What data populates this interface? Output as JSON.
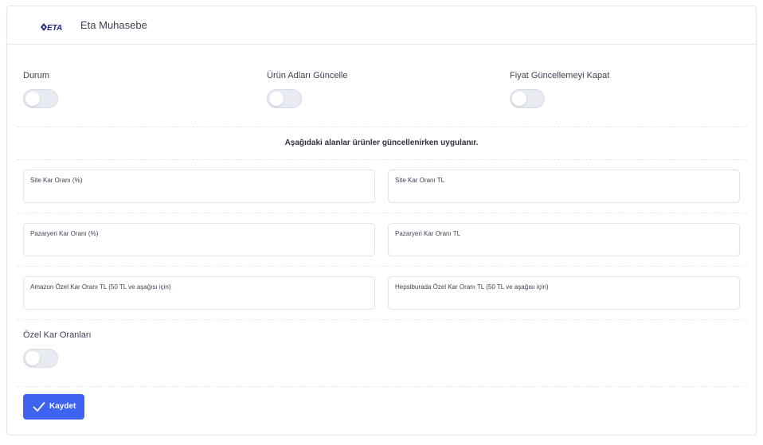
{
  "header": {
    "logo_text": "ETA",
    "title": "Eta Muhasebe"
  },
  "toggles": {
    "durum": {
      "label": "Durum",
      "checked": false
    },
    "urun_adlari": {
      "label": "Ürün Adları Güncelle",
      "checked": false
    },
    "fiyat_kapat": {
      "label": "Fiyat Güncellemeyi Kapat",
      "checked": false
    },
    "ozel_kar": {
      "label": "Özel Kar Oranları",
      "checked": false
    }
  },
  "section_note": "Aşağıdaki alanlar ürünler güncellenirken uygulanır.",
  "fields": {
    "site_kar_yuzde": {
      "label": "Site Kar Oranı (%)",
      "value": ""
    },
    "site_kar_tl": {
      "label": "Site Kar Oranı TL",
      "value": ""
    },
    "pazaryeri_kar_yuzde": {
      "label": "Pazaryeri Kar Oranı (%)",
      "value": ""
    },
    "pazaryeri_kar_tl": {
      "label": "Pazaryeri Kar Oranı TL",
      "value": ""
    },
    "amazon_ozel": {
      "label": "Amazon Özel Kar Oranı TL (50 TL ve aşağısı için)",
      "value": ""
    },
    "hepsiburada_ozel": {
      "label": "Hepsiburada Özel Kar Oranı TL (50 TL ve aşağısı için)",
      "value": ""
    }
  },
  "actions": {
    "save_label": "Kaydet"
  },
  "colors": {
    "primary": "#3e63f0",
    "toggle_off": "#e9ebf2",
    "logo": "#1f2a7a"
  }
}
